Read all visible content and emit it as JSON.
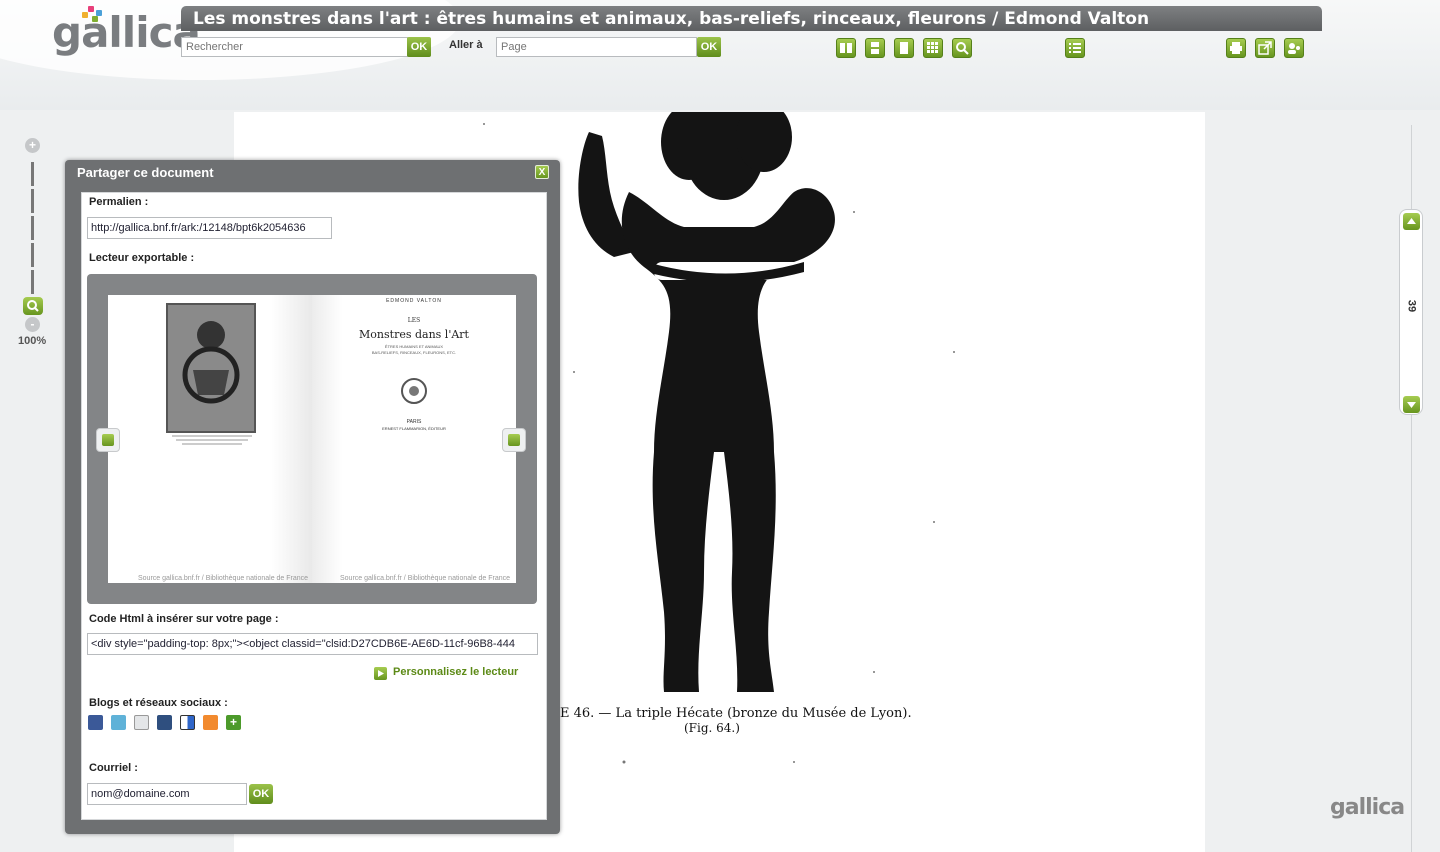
{
  "logo": {
    "text": "gallica"
  },
  "document_title": "Les monstres dans l'art : êtres humains et animaux, bas-reliefs, rinceaux, fleurons / Edmond Valton",
  "search": {
    "placeholder": "Rechercher",
    "ok_label": "OK"
  },
  "goto": {
    "label": "Aller à",
    "placeholder": "Page",
    "ok_label": "OK"
  },
  "toolbar": {
    "view_tools": [
      "double-page-icon",
      "single-page-icon",
      "page-icon",
      "grid-icon",
      "search-icon"
    ],
    "list_tool": "list-icon",
    "right_tools": [
      "print-icon",
      "export-icon",
      "share-icon"
    ]
  },
  "zoom": {
    "plus": "+",
    "minus": "-",
    "level": "100%"
  },
  "page_nav": {
    "current_page": "39"
  },
  "document_caption": {
    "line1": "E 46. — La triple Hécate (bronze du Musée de Lyon).",
    "line2": "(Fig. 64.)"
  },
  "share_dialog": {
    "title": "Partager ce document",
    "close_label": "X",
    "permalink_label": "Permalien :",
    "permalink_value": "http://gallica.bnf.fr/ark:/12148/bpt6k2054636",
    "exportable_label": "Lecteur exportable :",
    "viewer": {
      "right_page": {
        "author": "EDMOND VALTON",
        "les": "LES",
        "title": "Monstres dans l'Art",
        "subtitle1": "ÊTRES HUMAINS ET ANIMAUX",
        "subtitle2": "BAS-RELIEFS, RINCEAUX, FLEURONS, ETC.",
        "city": "PARIS",
        "publisher": "ERNEST FLAMMARION, ÉDITEUR"
      },
      "source_left": "Source gallica.bnf.fr / Bibliothèque nationale de France",
      "source_right": "Source gallica.bnf.fr / Bibliothèque nationale de France"
    },
    "html_code_label": "Code Html à insérer sur votre page :",
    "html_code_value": "<div style=\"padding-top: 8px;\"><object classid=\"clsid:D27CDB6E-AE6D-11cf-96B8-444",
    "customize_label": "Personnalisez le lecteur",
    "social_label": "Blogs et réseaux sociaux :",
    "social_icons": [
      "facebook-icon",
      "twitter-icon",
      "google-icon",
      "myspace-icon",
      "delicious-icon",
      "blogger-icon",
      "add-icon"
    ],
    "email_label": "Courriel :",
    "email_value": "nom@domaine.com",
    "email_ok": "OK"
  },
  "colors": {
    "accent": "#7fae2f",
    "titlebar": "#6b6d6f",
    "dialog": "#6e7072"
  }
}
